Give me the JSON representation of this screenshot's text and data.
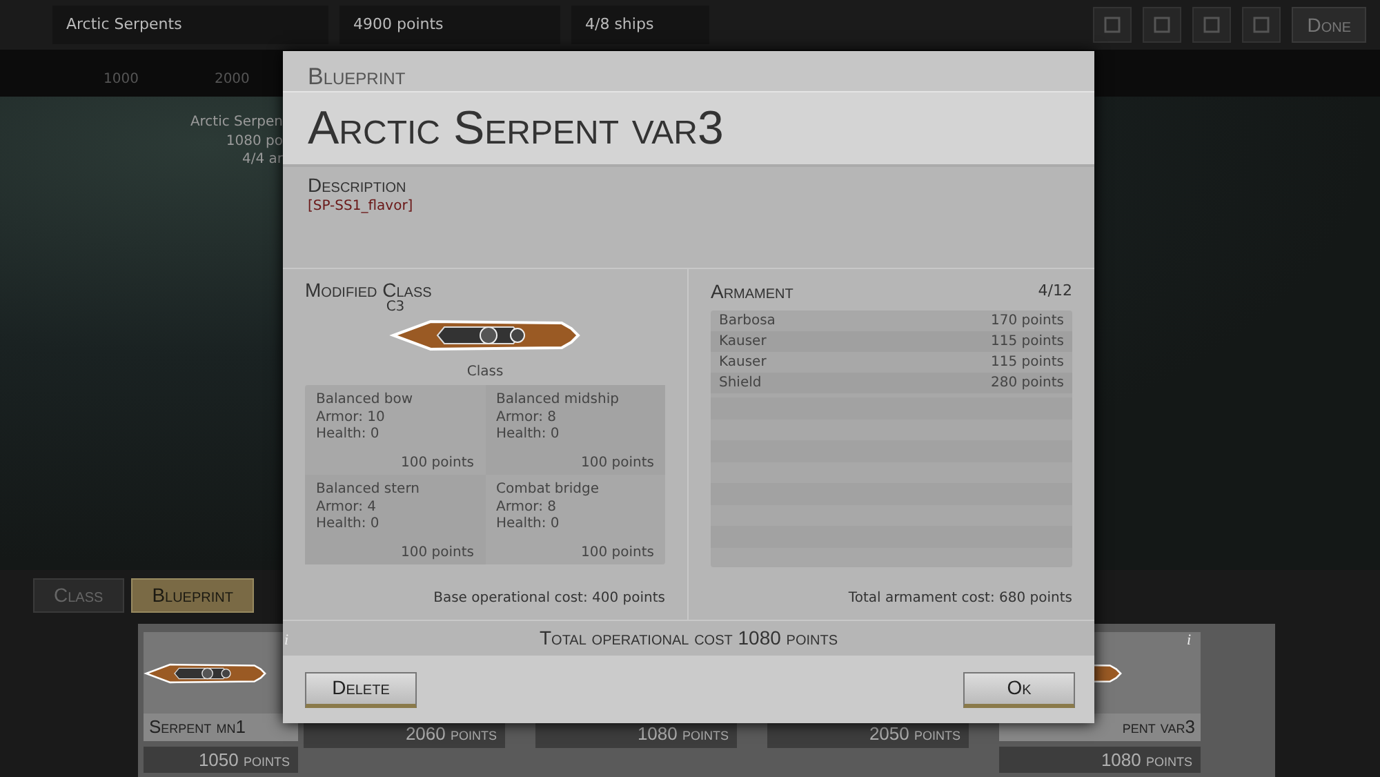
{
  "top_bar": {
    "fleet_name": "Arctic Serpents",
    "points": "4900 points",
    "ships": "4/8 ships",
    "done_button": "Done"
  },
  "ruler": {
    "ticks": [
      "1000",
      "2000"
    ]
  },
  "map": {
    "unit_label": [
      "Arctic Serpen",
      "1080 po",
      "4/4 ar"
    ]
  },
  "bottom_tabs": [
    {
      "label": "Class",
      "selected": false
    },
    {
      "label": "Blueprint",
      "selected": true
    }
  ],
  "ship_cards": [
    {
      "name": "Serpent mn1",
      "points": "1050 points",
      "info": "i"
    },
    {
      "points": "2060 points"
    },
    {
      "points": "1080 points"
    },
    {
      "points": "2050 points"
    },
    {
      "name": "pent var3",
      "points": "1080 points",
      "info": "i"
    }
  ],
  "dialog": {
    "kicker": "Blueprint",
    "title": "Arctic Serpent var3",
    "description_heading": "Description",
    "description": "[SP-SS1_flavor]",
    "class_section": {
      "heading": "Modified Class",
      "class_code": "C3",
      "class_label": "Class",
      "base_cost": "Base operational cost: 400 points",
      "parts": [
        {
          "name": "Balanced bow",
          "armor": "Armor: 10",
          "health": "Health: 0",
          "points": "100 points"
        },
        {
          "name": "Balanced midship",
          "armor": "Armor: 8",
          "health": "Health: 0",
          "points": "100 points"
        },
        {
          "name": "Balanced stern",
          "armor": "Armor: 4",
          "health": "Health: 0",
          "points": "100 points"
        },
        {
          "name": "Combat bridge",
          "armor": "Armor: 8",
          "health": "Health: 0",
          "points": "100 points"
        }
      ]
    },
    "armament": {
      "heading": "Armament",
      "count": "4/12",
      "total": "Total armament cost: 680 points",
      "items": [
        {
          "name": "Barbosa",
          "points": "170 points"
        },
        {
          "name": "Kauser",
          "points": "115 points"
        },
        {
          "name": "Kauser",
          "points": "115 points"
        },
        {
          "name": "Shield",
          "points": "280 points"
        }
      ]
    },
    "total": "Total operational cost 1080 points",
    "delete_button": "Delete",
    "ok_button": "Ok"
  }
}
